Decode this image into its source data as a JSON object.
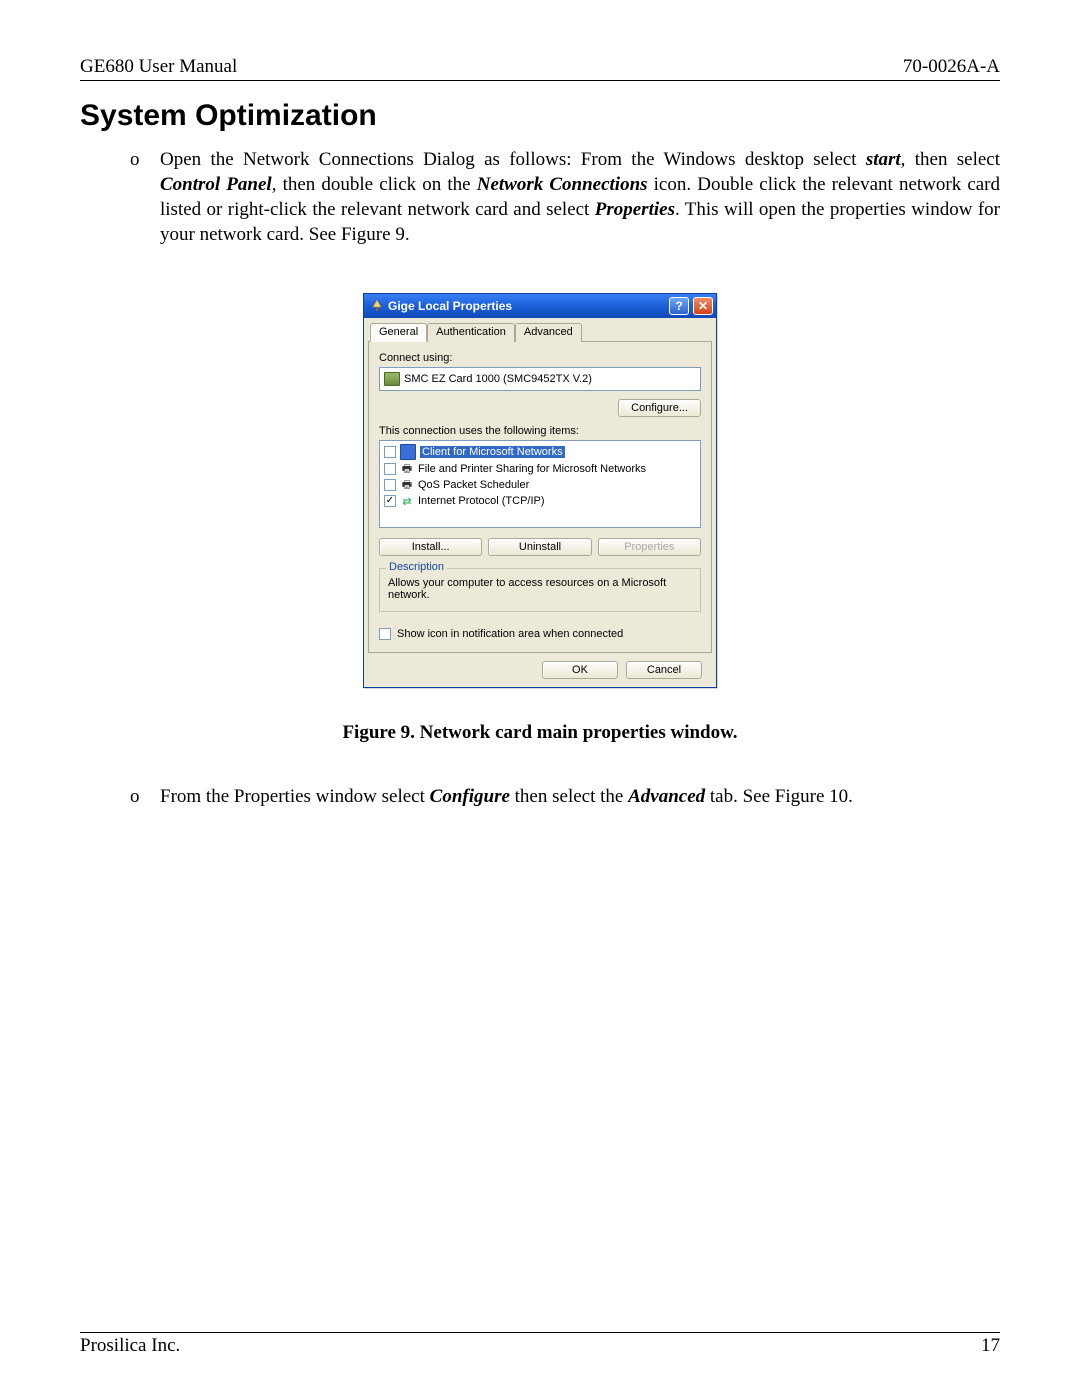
{
  "header": {
    "left": "GE680 User Manual",
    "right": "70-0026A-A"
  },
  "title": "System Optimization",
  "para1": {
    "t1": "Open the Network Connections Dialog as follows: From the Windows desktop select ",
    "b1": "start",
    "t2": ", then select ",
    "b2": "Control Panel",
    "t3": ", then double click on the ",
    "b3": "Network Connections",
    "t4": " icon. Double click the relevant network card listed or right-click the relevant network card and select ",
    "b4": "Properties",
    "t5": ". This will open the properties window for your network card. See Figure 9."
  },
  "dialog": {
    "title": "Gige Local Properties",
    "tabs": [
      "General",
      "Authentication",
      "Advanced"
    ],
    "connect_label": "Connect using:",
    "adapter": "SMC EZ Card 1000 (SMC9452TX V.2)",
    "configure": "Configure...",
    "items_label": "This connection uses the following items:",
    "items": [
      {
        "checked": false,
        "icon": "monitor",
        "label": "Client for Microsoft Networks",
        "selected": true
      },
      {
        "checked": false,
        "icon": "printer",
        "label": "File and Printer Sharing for Microsoft Networks",
        "selected": false
      },
      {
        "checked": false,
        "icon": "printer",
        "label": "QoS Packet Scheduler",
        "selected": false
      },
      {
        "checked": true,
        "icon": "net",
        "label": "Internet Protocol (TCP/IP)",
        "selected": false
      }
    ],
    "install": "Install...",
    "uninstall": "Uninstall",
    "properties": "Properties",
    "desc_title": "Description",
    "desc_text": "Allows your computer to access resources on a Microsoft network.",
    "show_icon": "Show icon in notification area when connected",
    "ok": "OK",
    "cancel": "Cancel"
  },
  "caption": "Figure 9. Network card main properties window.",
  "para2": {
    "t1": "From the Properties window select ",
    "b1": "Configure",
    "t2": " then select the ",
    "b2": "Advanced",
    "t3": " tab. See Figure 10."
  },
  "footer": {
    "left": "Prosilica Inc.",
    "right": "17"
  }
}
